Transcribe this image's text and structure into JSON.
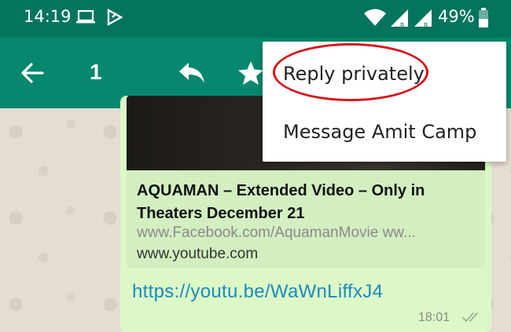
{
  "status_bar": {
    "time": "14:19",
    "battery_percent": "49%",
    "icons": [
      "laptop-icon",
      "play-store-icon",
      "wifi-icon",
      "signal-icon",
      "signal-icon",
      "battery-icon"
    ]
  },
  "toolbar": {
    "selected_count": "1",
    "icons": [
      "back-arrow-icon",
      "reply-icon",
      "star-icon"
    ]
  },
  "message": {
    "preview": {
      "title": "AQUAMAN – Extended Video – Only in Theaters December 21",
      "description": "www.Facebook.com/AquamanMovie ww...",
      "domain": "www.youtube.com"
    },
    "link": "https://youtu.be/WaWnLiffxJ4",
    "time": "18:01"
  },
  "popup_menu": {
    "items": [
      {
        "label": "Reply privately"
      },
      {
        "label": "Message Amit Camp"
      }
    ]
  },
  "colors": {
    "status_bar": "#05745f",
    "toolbar": "#07876d",
    "bubble": "#dcf8c6",
    "link": "#1a8bbf",
    "annotation_circle": "#d4141c"
  }
}
